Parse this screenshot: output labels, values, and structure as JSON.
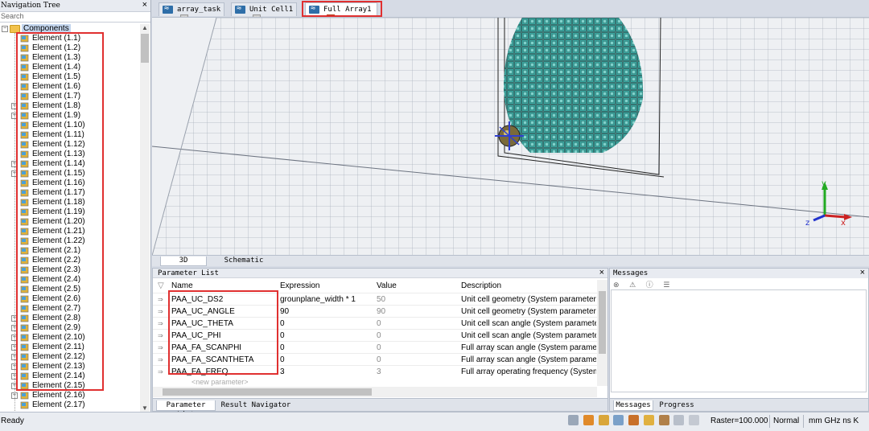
{
  "nav": {
    "title": "Navigation Tree",
    "close": "×",
    "search_placeholder": "Search",
    "root": "Components",
    "elements": [
      "Element (1.1)",
      "Element (1.2)",
      "Element (1.3)",
      "Element (1.4)",
      "Element (1.5)",
      "Element (1.6)",
      "Element (1.7)",
      "Element (1.8)",
      "Element (1.9)",
      "Element (1.10)",
      "Element (1.11)",
      "Element (1.12)",
      "Element (1.13)",
      "Element (1.14)",
      "Element (1.15)",
      "Element (1.16)",
      "Element (1.17)",
      "Element (1.18)",
      "Element (1.19)",
      "Element (1.20)",
      "Element (1.21)",
      "Element (1.22)",
      "Element (2.1)",
      "Element (2.2)",
      "Element (2.3)",
      "Element (2.4)",
      "Element (2.5)",
      "Element (2.6)",
      "Element (2.7)",
      "Element (2.8)",
      "Element (2.9)",
      "Element (2.10)",
      "Element (2.11)",
      "Element (2.12)",
      "Element (2.13)",
      "Element (2.14)",
      "Element (2.15)",
      "Element (2.16)",
      "Element (2.17)"
    ],
    "expandable": [
      7,
      8,
      13,
      14,
      29,
      30,
      31,
      32,
      33,
      34,
      35,
      36,
      37
    ]
  },
  "tabs": [
    {
      "label": "array_task",
      "active": false
    },
    {
      "label": "Unit Cell1",
      "active": false
    },
    {
      "label": "Full Array1",
      "active": true
    }
  ],
  "view_tabs": [
    "3D",
    "Schematic"
  ],
  "axes": {
    "x": "x",
    "y": "y",
    "z": "z"
  },
  "params": {
    "title": "Parameter List",
    "close": "×",
    "columns": {
      "name": "Name",
      "expression": "Expression",
      "value": "Value",
      "description": "Description"
    },
    "rows": [
      {
        "name": "PAA_UC_DS2",
        "expression": "grounplane_width * 1",
        "value": "50",
        "description": "Unit cell geometry (System parameter)"
      },
      {
        "name": "PAA_UC_ANGLE",
        "expression": "90",
        "value": "90",
        "description": "Unit cell geometry (System parameter)"
      },
      {
        "name": "PAA_UC_THETA",
        "expression": "0",
        "value": "0",
        "description": "Unit cell scan angle (System parameter)"
      },
      {
        "name": "PAA_UC_PHI",
        "expression": "0",
        "value": "0",
        "description": "Unit cell scan angle (System parameter)"
      },
      {
        "name": "PAA_FA_SCANPHI",
        "expression": "0",
        "value": "0",
        "description": "Full array scan angle (System parameter)"
      },
      {
        "name": "PAA_FA_SCANTHETA",
        "expression": "0",
        "value": "0",
        "description": "Full array scan angle (System parameter)"
      },
      {
        "name": "PAA_FA_FREQ",
        "expression": "3",
        "value": "3",
        "description": "Full array operating frequency (System parameter)"
      }
    ],
    "new_param": "<new parameter>",
    "bottom_tabs": [
      "Parameter List",
      "Result Navigator"
    ]
  },
  "messages": {
    "title": "Messages",
    "close": "×",
    "bottom_tabs": [
      "Messages",
      "Progress"
    ]
  },
  "status": {
    "ready": "Ready",
    "raster": "Raster=100.000",
    "mode": "Normal",
    "units": "mm  GHz  ns  K"
  },
  "colors": {
    "highlight": "#e03030",
    "array_fill": "#3aa6a0",
    "cell_stroke": "#1d5f5b"
  }
}
